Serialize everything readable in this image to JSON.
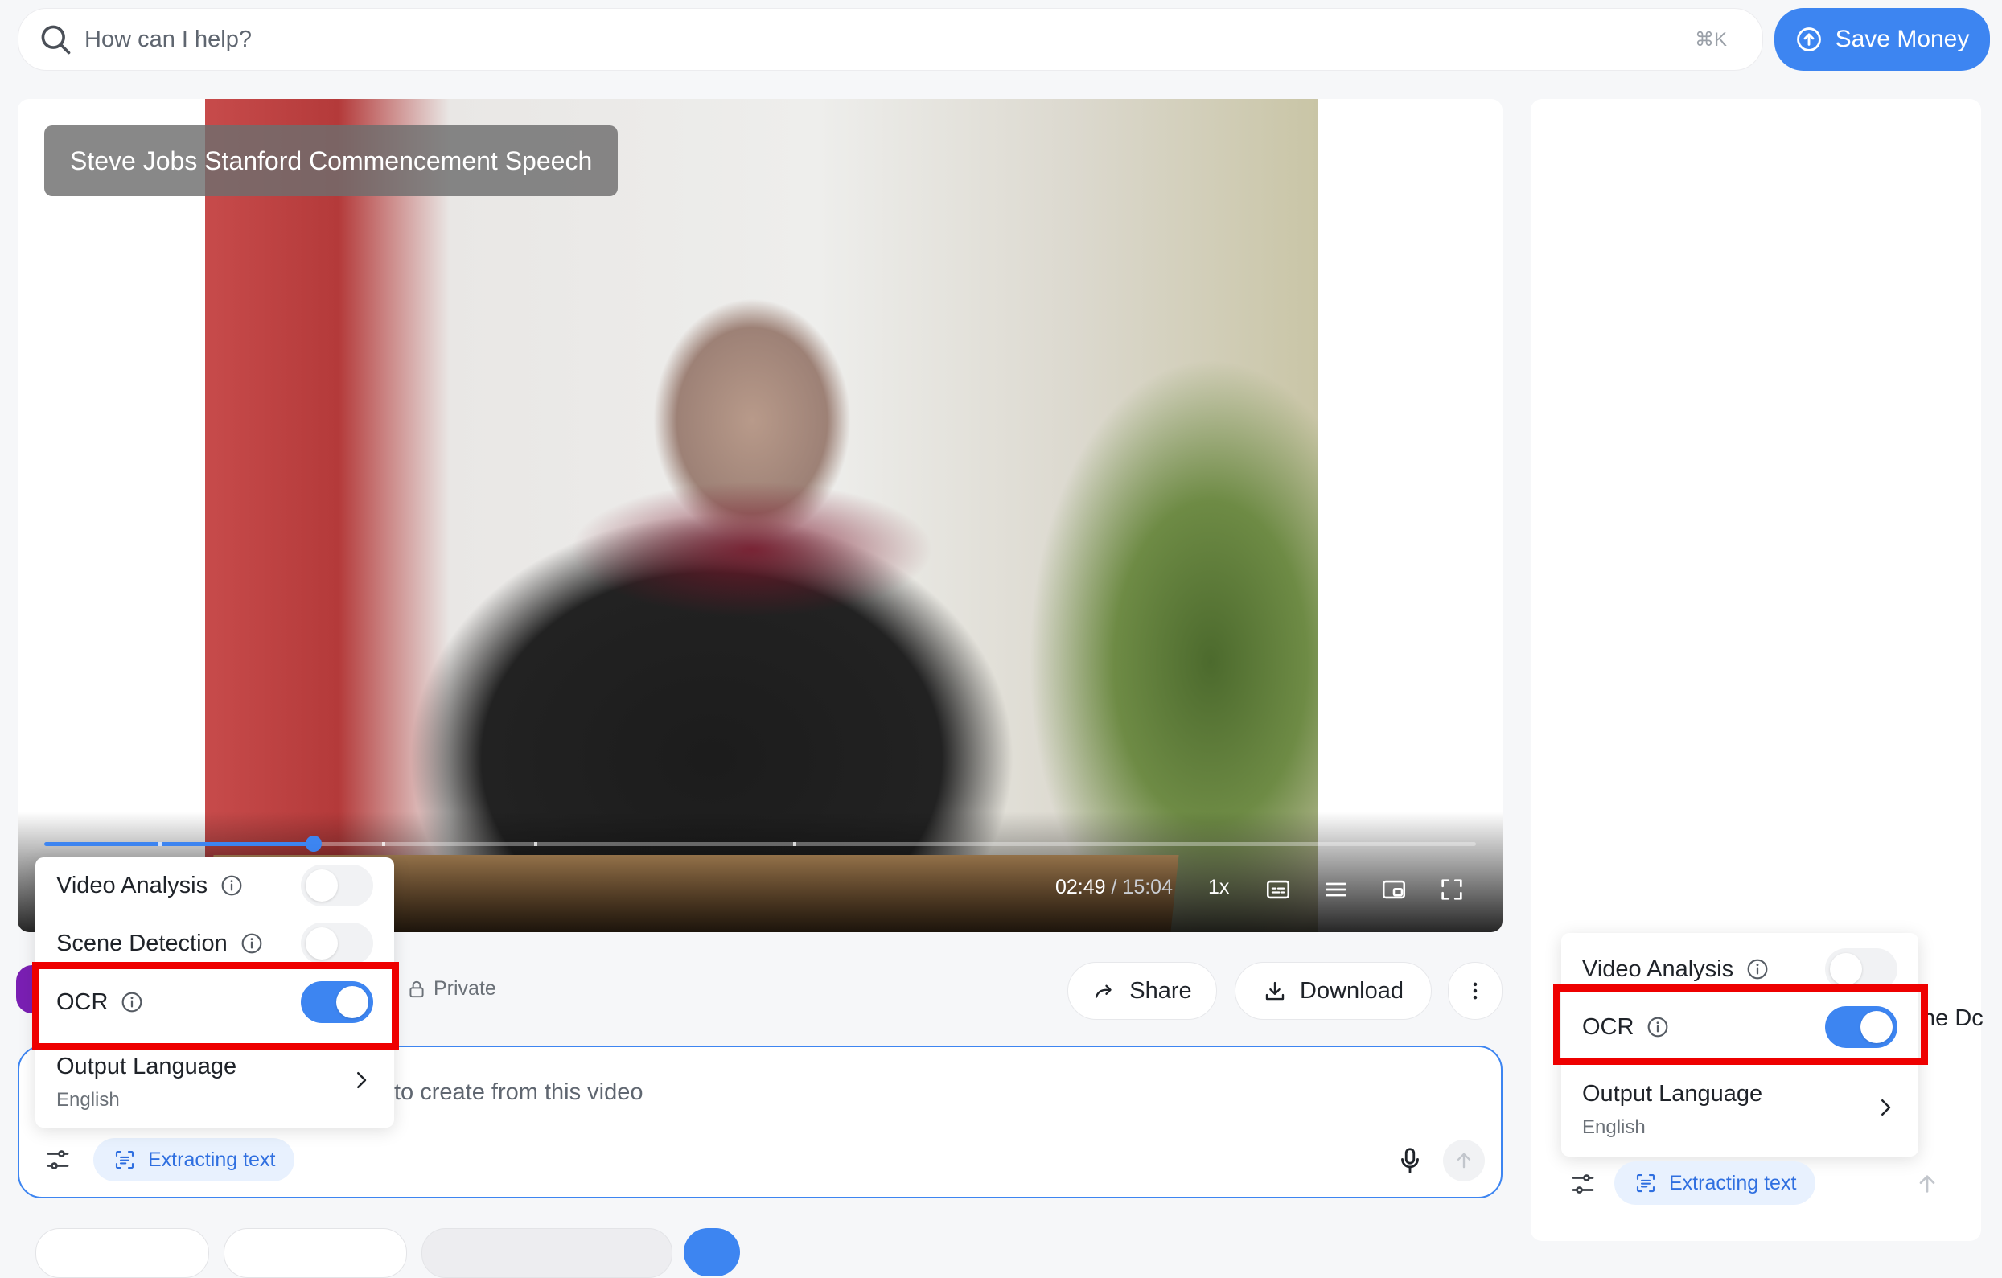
{
  "topbar": {
    "search_placeholder": "How can I help?",
    "shortcut": "⌘K",
    "save_button": "Save Money"
  },
  "video": {
    "title": "Steve Jobs Stanford Commencement Speech",
    "current_time": "02:49",
    "separator": "/",
    "duration": "15:04",
    "speed": "1x",
    "progress_percent": 18.8
  },
  "info_row": {
    "visibility": "Private",
    "share_label": "Share",
    "download_label": "Download"
  },
  "prompt": {
    "placeholder_visible": "to create from this video",
    "extract_chip": "Extracting text"
  },
  "settings_left": {
    "video_analysis": {
      "label": "Video Analysis",
      "enabled": false
    },
    "scene_detection": {
      "label": "Scene Detection",
      "enabled": false
    },
    "ocr": {
      "label": "OCR",
      "enabled": true
    },
    "output_language": {
      "label": "Output Language",
      "value": "English"
    }
  },
  "settings_right": {
    "video_analysis": {
      "label": "Video Analysis",
      "enabled": false
    },
    "ocr": {
      "label": "OCR",
      "enabled": true
    },
    "output_language": {
      "label": "Output Language",
      "value": "English"
    },
    "extract_chip": "Extracting text",
    "clipped_text": "ne Dc"
  },
  "colors": {
    "accent": "#3d85f1",
    "highlight": "#ee0000",
    "avatar": "#7a1fb3"
  }
}
